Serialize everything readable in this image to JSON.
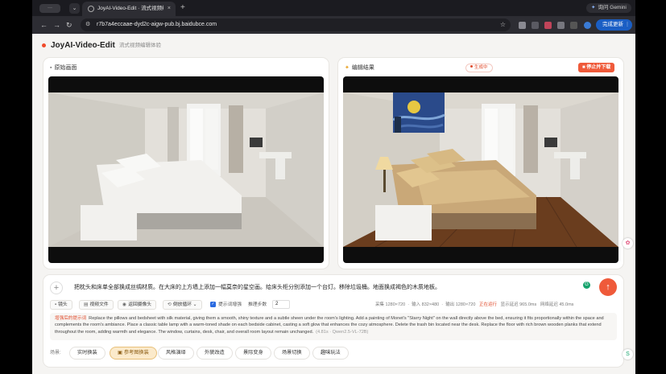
{
  "browser": {
    "tab_group_label": "···",
    "tab_title": "JoyAI-Video-Edit · 流式视频编辑体验",
    "tab_close": "×",
    "new_tab": "+",
    "gemini_label": "询问 Gemini",
    "url": "r7b7a4eccaae-dyd2c-aigw-pub.bj.baidubce.com",
    "update_label": "完成更新"
  },
  "header": {
    "title": "JoyAI-Video-Edit",
    "subtitle": "流式视频编辑体验"
  },
  "source_panel": {
    "title": "原始画面"
  },
  "result_panel": {
    "title": "编辑结果",
    "status": "生成中",
    "stop_label": "停止并下载"
  },
  "prompt": {
    "text": "把枕头和床单全部换成丝绸材质。在大床的上方墙上添加一幅莫奈的星空画。给床头柜分别添加一个台灯。移除垃圾桶。地面换成褐色的木质地板。",
    "tools": {
      "camera": "镜头",
      "video_file": "视频文件",
      "stream_cam": "返回摄像头",
      "loop": "倒放循环",
      "enhance_label": "提示词增强",
      "steps_label": "推理步数",
      "steps_value": "2"
    },
    "stats": {
      "capture_label": "采集",
      "capture_value": "1280×720",
      "input_label": "输入",
      "input_value": "832×480",
      "output_label": "输出",
      "output_value": "1280×720",
      "running": "正在运行",
      "display_delay_label": "显示延迟",
      "display_delay_value": "965.0ms",
      "net_delay_label": "网络延迟",
      "net_delay_value": "45.0ms"
    },
    "optimized_label": "增强后的提示词",
    "optimized_text": "Replace the pillows and bedsheet with silk material, giving them a smooth, shiny texture and a subtle sheen under the room's lighting. Add a painting of Monet's \"Starry Night\" on the wall directly above the bed, ensuring it fits proportionally within the space and complements the room's ambiance. Place a classic table lamp with a warm-toned shade on each bedside cabinet, casting a soft glow that enhances the cozy atmosphere. Delete the trash bin located near the desk. Replace the floor with rich brown wooden planks that extend throughout the room, adding warmth and elegance. The window, curtains, desk, chair, and overall room layout remain unchanged.",
    "optimized_meta": "(4.81s · Qwen2.5-VL-72B)"
  },
  "presets": {
    "label": "场景:",
    "items": [
      "实时换装",
      "参考图换装",
      "风格演绎",
      "外貌改造",
      "景际变身",
      "场景切换",
      "趣味玩法"
    ]
  },
  "colors": {
    "accent": "#ef5a3a",
    "chip_active_bg": "#fbeacb",
    "update_blue": "#1a5ec4"
  }
}
